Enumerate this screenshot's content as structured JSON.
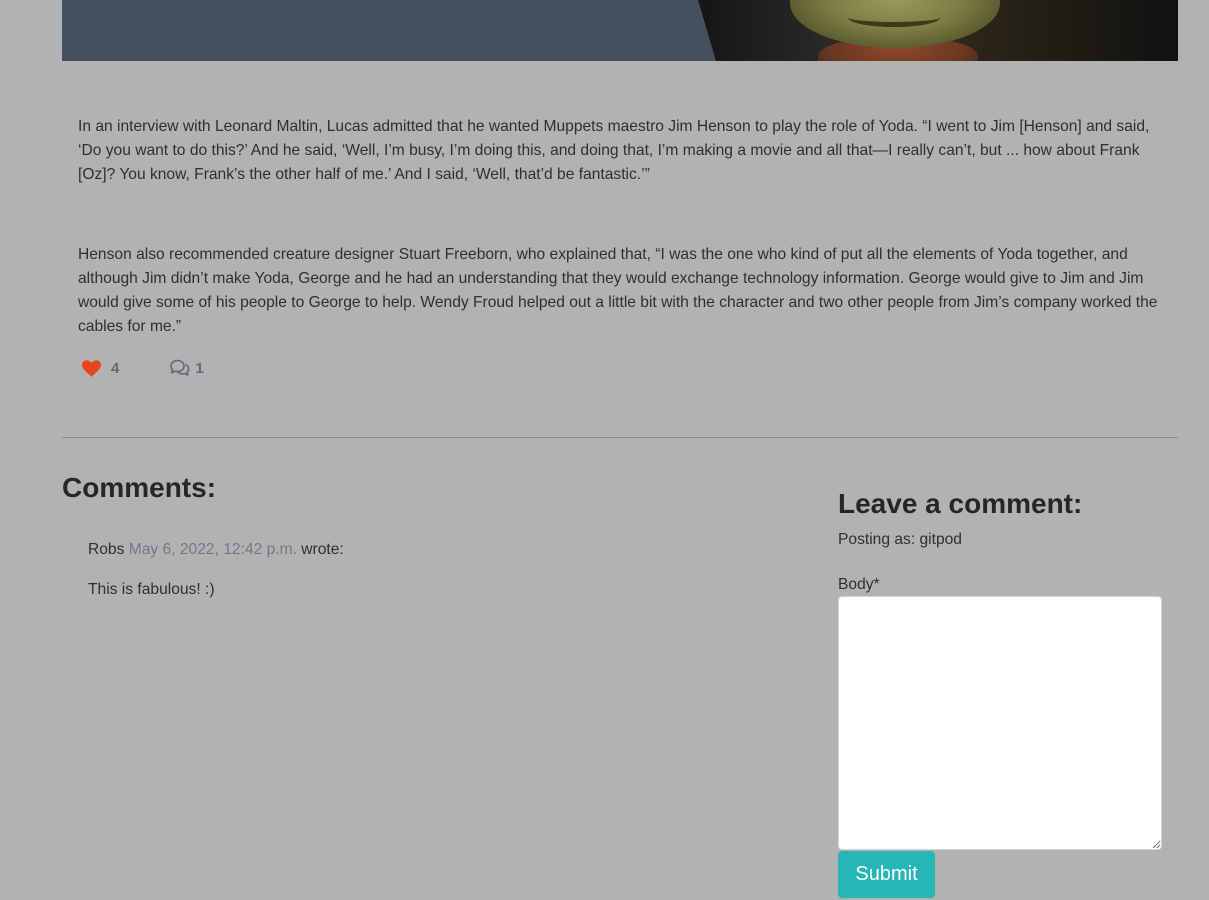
{
  "colors": {
    "page_background": "#b2b2b2",
    "hero_panel": "#45505e",
    "like_heart": "#e8451c",
    "reaction_text": "#5f6b7a",
    "submit_button": "#26b6b6",
    "comment_date": "#6e7a86"
  },
  "hero": {
    "image_subject": "Yoda"
  },
  "post": {
    "paragraphs": [
      "In an interview with Leonard Maltin, Lucas admitted that he wanted Muppets maestro Jim Henson to play the role of Yoda. “I went to Jim [Henson] and said, ‘Do you want to do this?’ And he said, ‘Well, I’m busy, I’m doing this, and doing that, I’m making a movie and all that—I really can’t, but ... how about Frank [Oz]? You know, Frank’s the other half of me.’ And I said, ‘Well, that’d be fantastic.’”",
      "Henson also recommended creature designer Stuart Freeborn, who explained that, “I was the one who kind of put all the elements of Yoda together, and although Jim didn’t make Yoda, George and he had an understanding that they would exchange technology information. George would give to Jim and Jim would give some of his people to George to help. Wendy Froud helped out a little bit with the character and two other people from Jim’s company worked the cables for me.”"
    ],
    "likes": {
      "icon": "heart-icon",
      "count": "4"
    },
    "comments_count": {
      "icon": "comment-bubbles-icon",
      "count": "1"
    }
  },
  "comments_section": {
    "heading": "Comments:",
    "comments": [
      {
        "author": "Robs",
        "date": "May 6, 2022, 12:42 p.m.",
        "wrote_label": "wrote:",
        "body": "This is fabulous! :)"
      }
    ]
  },
  "comment_form": {
    "heading": "Leave a comment:",
    "posting_as": "Posting as: gitpod",
    "body_label": "Body*",
    "body_value": "",
    "submit_label": "Submit"
  }
}
